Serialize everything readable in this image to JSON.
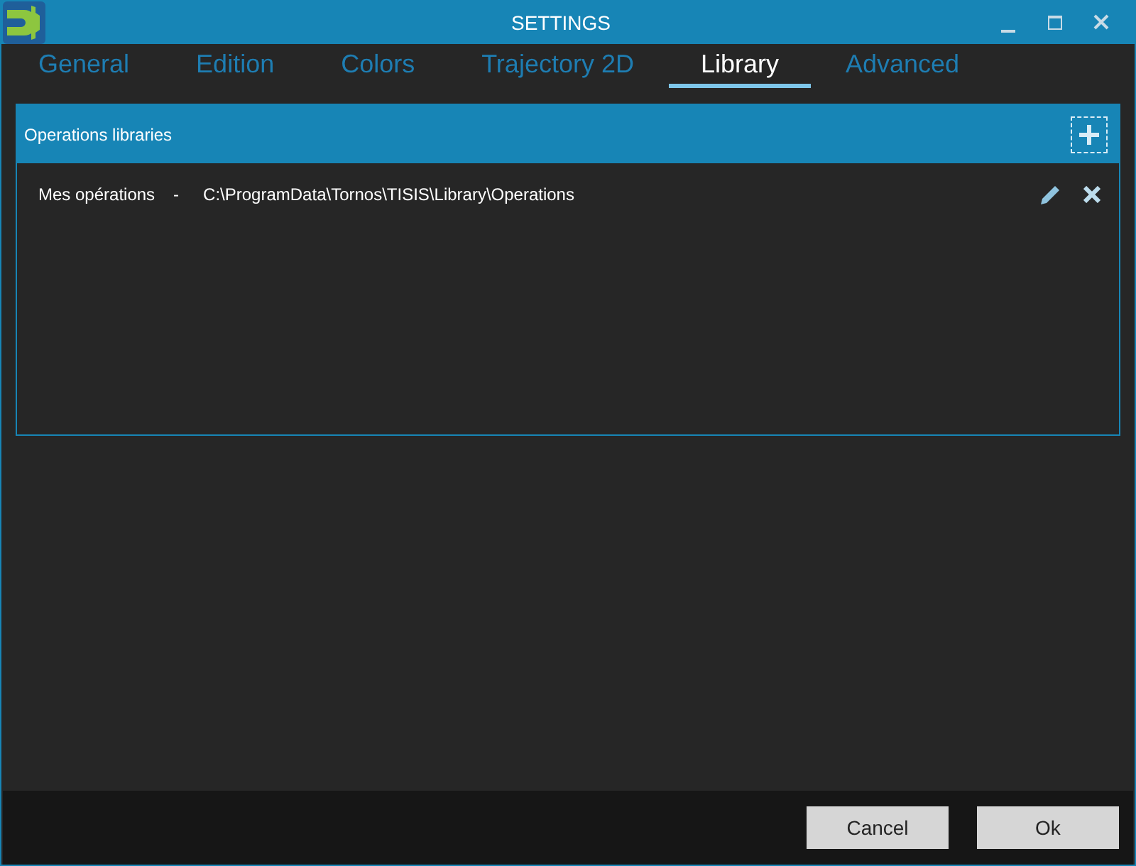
{
  "window": {
    "title": "SETTINGS"
  },
  "tabs": [
    {
      "label": "General",
      "selected": false
    },
    {
      "label": "Edition",
      "selected": false
    },
    {
      "label": "Colors",
      "selected": false
    },
    {
      "label": "Trajectory 2D",
      "selected": false
    },
    {
      "label": "Library",
      "selected": true
    },
    {
      "label": "Advanced",
      "selected": false
    }
  ],
  "libraries_panel": {
    "title": "Operations libraries",
    "items": [
      {
        "name": "Mes opérations",
        "separator": "-",
        "path": "C:\\ProgramData\\Tornos\\TISIS\\Library\\Operations"
      }
    ]
  },
  "buttons": [
    "Cancel",
    "Ok"
  ]
}
